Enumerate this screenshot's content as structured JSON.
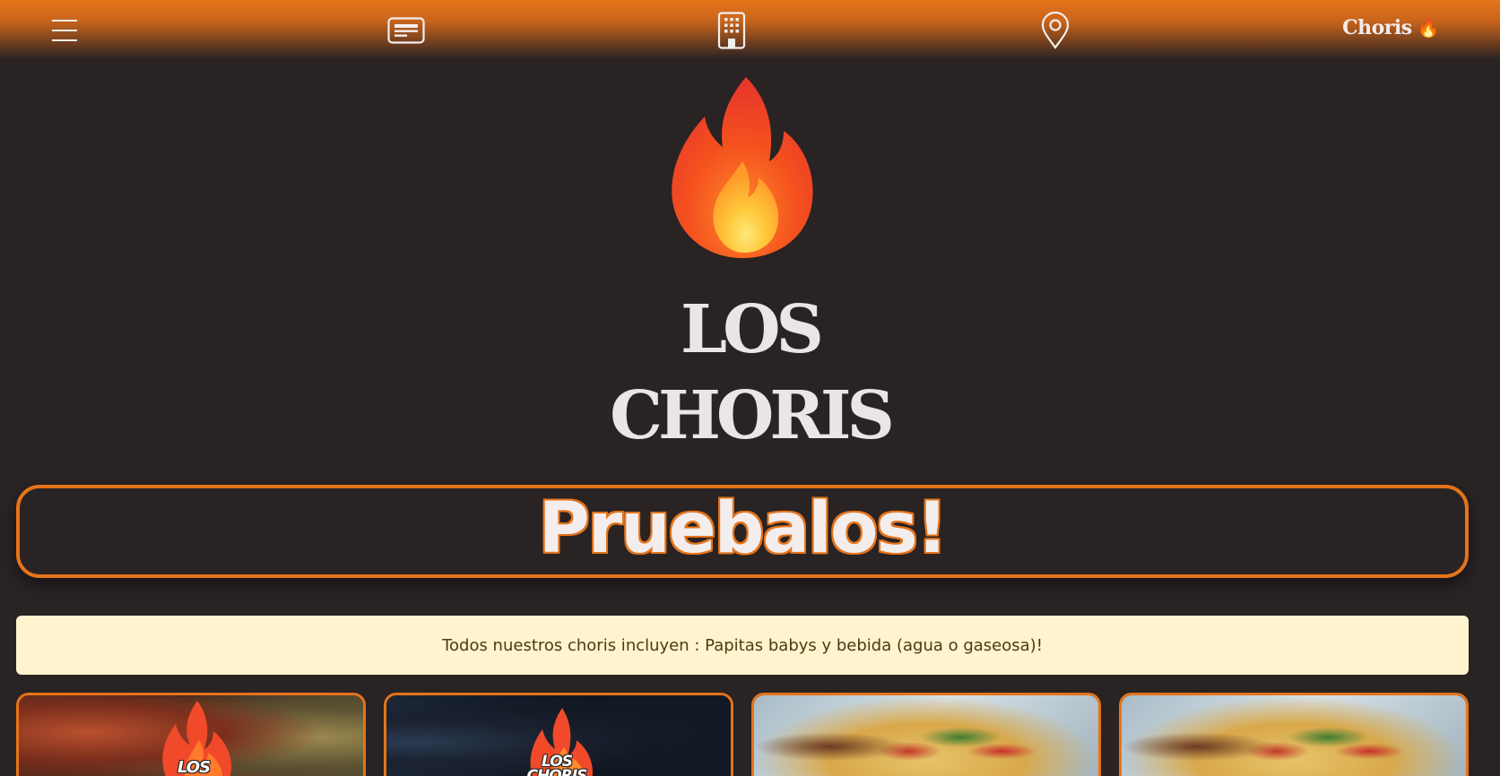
{
  "nav": {
    "menu_icon": "hamburger-menu-icon",
    "items": [
      {
        "icon": "card-text-icon",
        "label": ""
      },
      {
        "icon": "building-icon",
        "label": ""
      },
      {
        "icon": "map-pin-icon",
        "label": ""
      }
    ],
    "brand": "Choris",
    "brand_emoji": "🔥"
  },
  "hero": {
    "emoji": "🔥",
    "title_line1": "LOS",
    "title_line2": "CHORIS"
  },
  "cta": {
    "text": "Pruebalos!"
  },
  "note": {
    "text": "Todos nuestros choris incluyen : Papitas babys y bebida (agua o gaseosa)!"
  },
  "cards": [
    {
      "image": "grilled-meat-photo",
      "logo": "LOS"
    },
    {
      "image": "dark-plate-photo",
      "logo": "LOS CHORIS"
    },
    {
      "image": "taco-photo",
      "logo": ""
    },
    {
      "image": "taco-photo",
      "logo": ""
    }
  ],
  "colors": {
    "accent": "#e5741a",
    "background": "#292324",
    "note_bg": "#fff4cd",
    "text_light": "#ebe5e5"
  }
}
